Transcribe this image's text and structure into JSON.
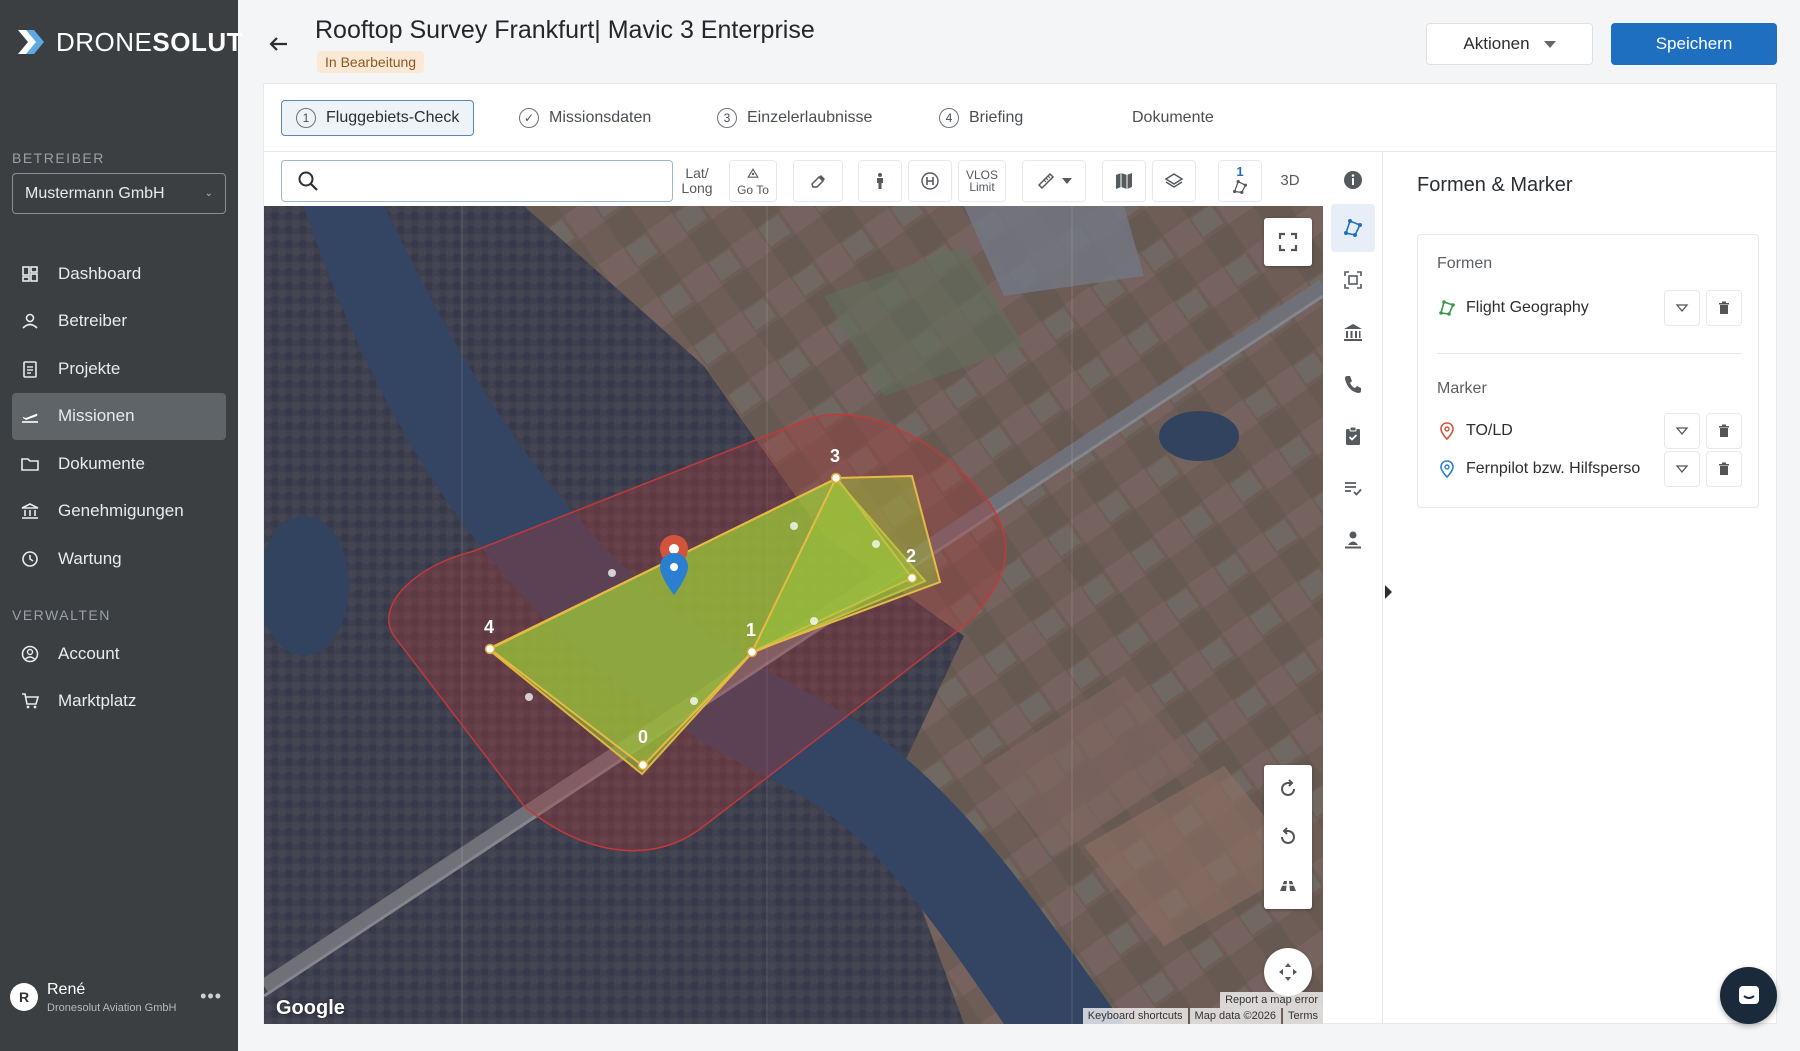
{
  "brand": {
    "name_light": "DRONE",
    "name_bold": "SOLUT"
  },
  "sidebar": {
    "operator_section": "BETREIBER",
    "operator_value": "Mustermann GmbH",
    "manage_section": "VERWALTEN",
    "items": [
      {
        "label": "Dashboard",
        "icon": "dashboard-icon"
      },
      {
        "label": "Betreiber",
        "icon": "person-icon"
      },
      {
        "label": "Projekte",
        "icon": "clipboard-icon"
      },
      {
        "label": "Missionen",
        "icon": "plane-icon",
        "active": true
      },
      {
        "label": "Dokumente",
        "icon": "folder-icon"
      },
      {
        "label": "Genehmigungen",
        "icon": "bank-icon"
      },
      {
        "label": "Wartung",
        "icon": "clock-icon"
      }
    ],
    "manage_items": [
      {
        "label": "Account",
        "icon": "account-icon"
      },
      {
        "label": "Marktplatz",
        "icon": "cart-icon"
      }
    ],
    "user": {
      "initial": "R",
      "name": "René",
      "org": "Dronesolut Aviation GmbH"
    }
  },
  "header": {
    "title": "Rooftop Survey Frankfurt| Mavic 3 Enterprise",
    "status": "In Bearbeitung",
    "actions_label": "Aktionen",
    "save_label": "Speichern"
  },
  "steps": [
    {
      "num": "1",
      "label": "Fluggebiets-Check",
      "active": true
    },
    {
      "num": "✓",
      "label": "Missionsdaten"
    },
    {
      "num": "3",
      "label": "Einzelerlaubnisse"
    },
    {
      "num": "4",
      "label": "Briefing"
    },
    {
      "num": "",
      "label": "Dokumente"
    }
  ],
  "toolbar": {
    "search_placeholder": "",
    "latlong_label_1": "Lat/",
    "latlong_label_2": "Long",
    "goto_label": "Go To",
    "vlos_label_1": "VLOS",
    "vlos_label_2": "Limit",
    "shapes_count": "1",
    "threed_label": "3D"
  },
  "map": {
    "vertex_labels": [
      "0",
      "1",
      "2",
      "3",
      "4"
    ],
    "google_label": "Google",
    "attribution": [
      "Keyboard shortcuts",
      "Map data ©2026",
      "Terms"
    ],
    "report_error": "Report a map error"
  },
  "panel": {
    "title": "Formen & Marker",
    "shapes_label": "Formen",
    "shapes": [
      {
        "label": "Flight Geography",
        "icon": "polygon-icon",
        "color": "#3a9a4a"
      }
    ],
    "markers_label": "Marker",
    "markers": [
      {
        "label": "TO/LD",
        "icon": "pin-icon",
        "color": "#d2543a"
      },
      {
        "label": "Fernpilot bzw. Hilfsperso",
        "icon": "pin-icon",
        "color": "#2a7fd0"
      }
    ]
  },
  "colors": {
    "accent": "#1e6fc0",
    "sidebar": "#3b3f42",
    "badge": "#fbe9d6"
  }
}
